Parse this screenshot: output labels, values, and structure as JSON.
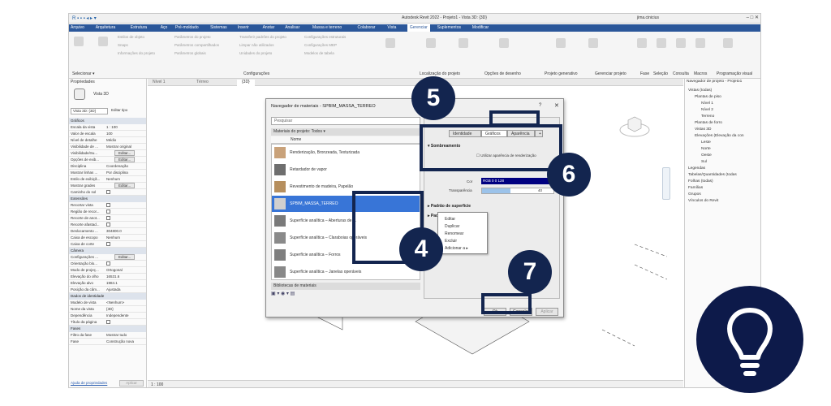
{
  "window": {
    "title": "Autodesk Revit 2022 - Projeto1 - Vista 3D: {3D}",
    "user": "jima.cinicius",
    "controls": [
      "–",
      "□",
      "✕"
    ]
  },
  "ribbon": {
    "tabs": [
      "Arquivo",
      "Arquitetura",
      "Estrutura",
      "Aço",
      "Pré-moldado",
      "Sistemas",
      "Inserir",
      "Anotar",
      "Analisar",
      "Massa e terreno",
      "Colaborar",
      "Vista",
      "Gerenciar",
      "Suplementos",
      "Modificar"
    ],
    "active_tab": "Gerenciar",
    "groups": [
      "Selecionar ▾",
      "Configurações",
      "Localização do projeto",
      "Opções de desenho",
      "Projeto generativo",
      "Gerenciar projeto",
      "Fase",
      "Seleção",
      "Consulta",
      "Macros",
      "Programação visual"
    ],
    "settings_items": [
      "Estilos de objeto",
      "Snaps",
      "Informações do projeto",
      "Parâmetros do projeto",
      "Parâmetros compartilhados",
      "Parâmetros globais",
      "Transferir padrões do projeto",
      "Limpar não utilizados",
      "Unidades do projeto",
      "Configurações estruturais",
      "Configurações MEP",
      "Modelos de tabela"
    ]
  },
  "properties": {
    "title": "Propriedades",
    "type_name": "Vista 3D",
    "selector": "Vista 3D: {3D}",
    "edit_type": "Editar tipo",
    "sections": [
      {
        "name": "Gráficos",
        "rows": [
          {
            "k": "Escala da vista",
            "v": "1 : 100"
          },
          {
            "k": "Valor de escala",
            "v": "100"
          },
          {
            "k": "Nível de detalhe",
            "v": "Médio"
          },
          {
            "k": "Visibilidade de ...",
            "v": "Mostrar original"
          },
          {
            "k": "Visibilidade/Su...",
            "v": "Editar..."
          },
          {
            "k": "Opções de exib...",
            "v": "Editar..."
          },
          {
            "k": "Disciplina",
            "v": "Coordenação"
          },
          {
            "k": "Mostrar linhas ...",
            "v": "Por disciplina"
          },
          {
            "k": "Estilo de exibiçã...",
            "v": "Nenhum"
          },
          {
            "k": "Mostrar grades",
            "v": "Editar..."
          },
          {
            "k": "Caminho do sol",
            "v": ""
          }
        ]
      },
      {
        "name": "Extensões",
        "rows": [
          {
            "k": "Recortar vista",
            "v": ""
          },
          {
            "k": "Região de recor...",
            "v": ""
          },
          {
            "k": "Recorte de anot...",
            "v": ""
          },
          {
            "k": "Recorte afastad...",
            "v": ""
          },
          {
            "k": "Deslocamento ...",
            "v": "304800.0"
          },
          {
            "k": "Caixa de escopo",
            "v": "Nenhum"
          },
          {
            "k": "Caixa de corte",
            "v": ""
          }
        ]
      },
      {
        "name": "Câmera",
        "rows": [
          {
            "k": "Configurações ...",
            "v": "Editar..."
          },
          {
            "k": "Orientação blo...",
            "v": ""
          },
          {
            "k": "Modo de projeç...",
            "v": "Ortogonal"
          },
          {
            "k": "Elevação do olho",
            "v": "16531.6"
          },
          {
            "k": "Elevação alvo",
            "v": "1984.1"
          },
          {
            "k": "Posição da câm...",
            "v": "Ajustada"
          }
        ]
      },
      {
        "name": "Dados de identidade",
        "rows": [
          {
            "k": "Modelo de vista",
            "v": "<Nenhum>"
          },
          {
            "k": "Nome da vista",
            "v": "{3D}"
          },
          {
            "k": "Dependência",
            "v": "Independente"
          },
          {
            "k": "Título da página",
            "v": ""
          }
        ]
      },
      {
        "name": "Fases",
        "rows": [
          {
            "k": "Filtro da fase",
            "v": "Mostrar tudo"
          },
          {
            "k": "Fase",
            "v": "Construção nova"
          }
        ]
      }
    ],
    "help_link": "Ajuda de propriedades",
    "apply": "Aplicar"
  },
  "view_tabs": [
    "Nível 1",
    "Térreo",
    "{3D}"
  ],
  "view_bar": {
    "scale": "1 : 100"
  },
  "browser": {
    "title": "Navegador de projeto - Projeto1",
    "items": [
      {
        "label": "Vistas (todas)",
        "indent": 0
      },
      {
        "label": "Plantas de piso",
        "indent": 1
      },
      {
        "label": "Nível 1",
        "indent": 2
      },
      {
        "label": "Nível 2",
        "indent": 2
      },
      {
        "label": "Terreno",
        "indent": 2
      },
      {
        "label": "Plantas de forro",
        "indent": 1
      },
      {
        "label": "Vistas 3D",
        "indent": 1
      },
      {
        "label": "Elevações (Elevação da con",
        "indent": 1
      },
      {
        "label": "Leste",
        "indent": 2
      },
      {
        "label": "Norte",
        "indent": 2
      },
      {
        "label": "Oeste",
        "indent": 2
      },
      {
        "label": "Sul",
        "indent": 2
      },
      {
        "label": "Legendas",
        "indent": 0
      },
      {
        "label": "Tabelas/Quantidades (todas",
        "indent": 0
      },
      {
        "label": "Folhas (todas)",
        "indent": 0
      },
      {
        "label": "Famílias",
        "indent": 0
      },
      {
        "label": "Grupos",
        "indent": 0
      },
      {
        "label": "Vínculos do Revit",
        "indent": 0
      }
    ]
  },
  "dialog": {
    "title": "Navegador de materiais - SPBIM_MASSA_TERREO",
    "help": "?",
    "close": "✕",
    "search_placeholder": "Pesquisar",
    "materials_header": "Materiais do projeto: Todos",
    "column_name": "Nome",
    "materials": [
      "Renderização, Bronzeada, Texturizada",
      "Retardador de vapor",
      "Revestimento de madeira, Papelão",
      "SPBIM_MASSA_TERREO",
      "Superfície analítica – Aberturas de ...",
      "Superfície analítica – Claraboias operáveis",
      "Superfície analítica – Forros",
      "Superfície analítica – Janelas operáveis"
    ],
    "selected_index": 3,
    "library_header": "Bibliotecas de materiais",
    "right_tabs": [
      "Identidade",
      "Gráficos",
      "Aparência",
      "+"
    ],
    "active_right_tab": "Gráficos",
    "shading_section": "Sombreamento",
    "use_render_appearance": "Utilizar aparência de renderização",
    "color_label": "Cor",
    "color_value": "RGB 0 0 128",
    "color_hex": "#000080",
    "transparency_label": "Transparência",
    "transparency_value": "40",
    "transparency_fraction": 0.4,
    "surface_pattern": "Padrão de superfície",
    "cut_pattern": "Padrão de corte",
    "ok": "Ok",
    "cancel": "Cancelar",
    "apply": "Aplicar"
  },
  "context_menu": [
    "Editar",
    "Duplicar",
    "Renomear",
    "Excluir",
    "Adicionar a"
  ],
  "callouts": [
    "4",
    "5",
    "6",
    "7"
  ],
  "colors": {
    "navy": "#13254f",
    "ribbon": "#2b579a",
    "selection": "#3875d7"
  }
}
